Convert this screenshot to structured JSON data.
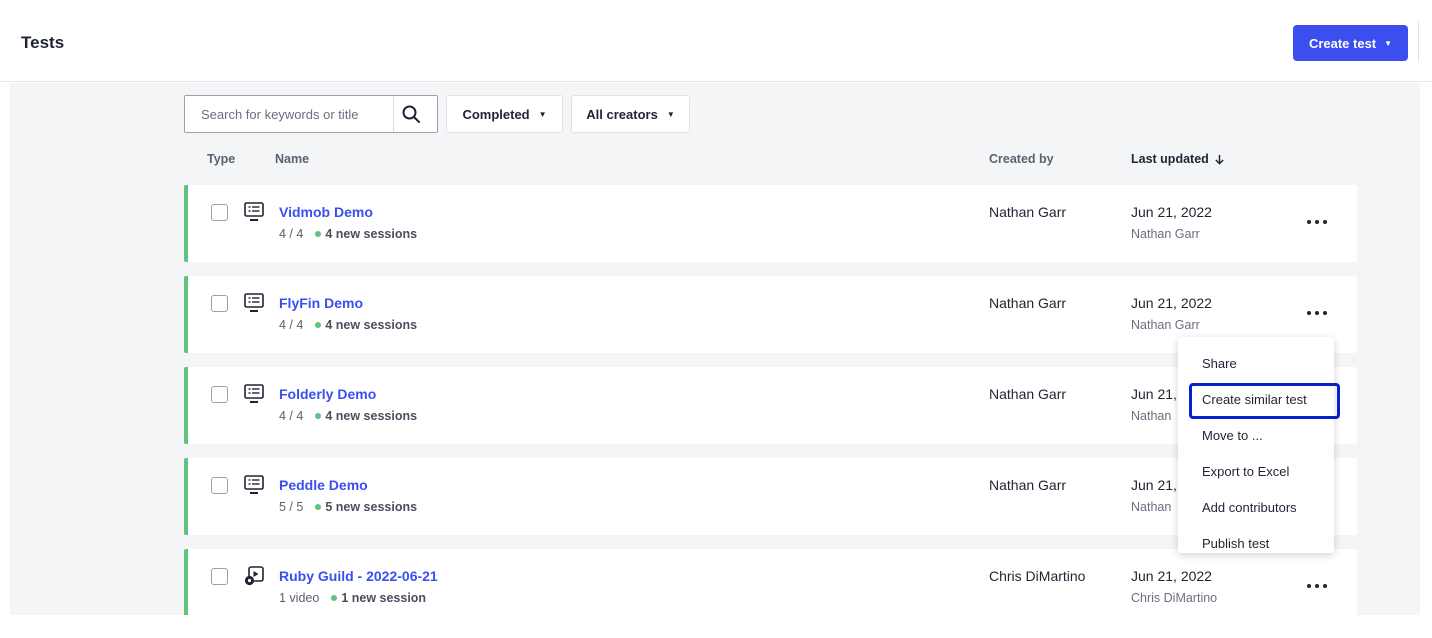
{
  "header": {
    "title": "Tests",
    "create_button": "Create test",
    "caret": "▼"
  },
  "toolbar": {
    "search_placeholder": "Search for keywords or title",
    "search_value": "",
    "status_filter": "Completed",
    "creator_filter": "All creators",
    "caret": "▼"
  },
  "columns": {
    "type": "Type",
    "name": "Name",
    "created_by": "Created by",
    "last_updated": "Last updated"
  },
  "rows": [
    {
      "type_icon": "screen-test-icon",
      "title": "Vidmob Demo",
      "progress": "4 / 4",
      "sessions": "4 new sessions",
      "created_by": "Nathan Garr",
      "date": "Jun 21, 2022",
      "updated_by": "Nathan Garr"
    },
    {
      "type_icon": "screen-test-icon",
      "title": "FlyFin Demo",
      "progress": "4 / 4",
      "sessions": "4 new sessions",
      "created_by": "Nathan Garr",
      "date": "Jun 21, 2022",
      "updated_by": "Nathan Garr"
    },
    {
      "type_icon": "screen-test-icon",
      "title": "Folderly Demo",
      "progress": "4 / 4",
      "sessions": "4 new sessions",
      "created_by": "Nathan Garr",
      "date": "Jun 21,",
      "updated_by": "Nathan"
    },
    {
      "type_icon": "screen-test-icon",
      "title": "Peddle Demo",
      "progress": "5 / 5",
      "sessions": "5 new sessions",
      "created_by": "Nathan Garr",
      "date": "Jun 21,",
      "updated_by": "Nathan"
    },
    {
      "type_icon": "video-test-icon",
      "title": "Ruby Guild - 2022-06-21",
      "progress": "1 video",
      "sessions": "1 new session",
      "created_by": "Chris DiMartino",
      "date": "Jun 21, 2022",
      "updated_by": "Chris DiMartino"
    }
  ],
  "context_menu": {
    "items": [
      "Share",
      "Create similar test",
      "Move to ...",
      "Export to Excel",
      "Add contributors",
      "Publish test"
    ],
    "highlighted": "Create similar test"
  },
  "colors": {
    "accent": "#3b4ef0",
    "status_green": "#5fc27e",
    "highlight_outline": "#0a1fcc",
    "background": "#f4f5f7"
  }
}
